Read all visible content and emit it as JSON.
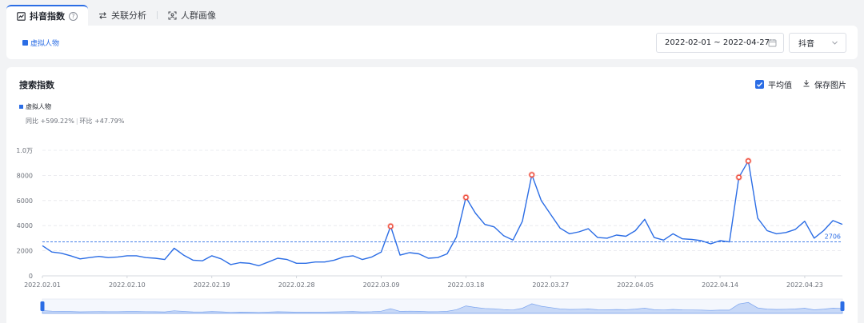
{
  "tabs": [
    {
      "label": "抖音指数",
      "icon": "trend-chart-icon",
      "active": true,
      "help": "?"
    },
    {
      "label": "关联分析",
      "icon": "swap-arrows-icon",
      "active": false
    },
    {
      "label": "人群画像",
      "icon": "face-scan-icon",
      "active": false
    }
  ],
  "filter": {
    "keyword": "虚拟人物",
    "date_range": "2022-02-01 ~ 2022-04-27",
    "platform": "抖音"
  },
  "chart_card": {
    "title": "搜索指数",
    "avg_label": "平均值",
    "avg_checked": true,
    "save_label": "保存图片",
    "series_name": "虚拟人物",
    "yoy": "同比 +599.22%",
    "stats_sep": "|",
    "mom": "环比 +47.79%"
  },
  "colors": {
    "accent": "#2b6de5",
    "peak": "#ef4d3c",
    "grid": "#e5e6eb"
  },
  "chart_data": {
    "type": "line",
    "title": "搜索指数",
    "xlabel": "",
    "ylabel": "",
    "ylim": [
      0,
      10000
    ],
    "y_ticks": [
      "0",
      "2000",
      "4000",
      "6000",
      "8000",
      "1.0万"
    ],
    "x_tick_labels": [
      "2022.02.01",
      "2022.02.10",
      "2022.02.19",
      "2022.02.28",
      "2022.03.09",
      "2022.03.18",
      "2022.03.27",
      "2022.04.05",
      "2022.04.14",
      "2022.04.23"
    ],
    "average": 2706,
    "average_label": "2706",
    "series": [
      {
        "name": "虚拟人物",
        "values": [
          2400,
          1900,
          1800,
          1600,
          1350,
          1450,
          1550,
          1450,
          1500,
          1600,
          1600,
          1450,
          1400,
          1300,
          2200,
          1650,
          1250,
          1200,
          1600,
          1350,
          900,
          1050,
          1000,
          800,
          1100,
          1400,
          1300,
          1000,
          1000,
          1100,
          1100,
          1250,
          1500,
          1600,
          1300,
          1500,
          1900,
          3950,
          1650,
          1850,
          1750,
          1400,
          1450,
          1750,
          3100,
          6250,
          5000,
          4100,
          3900,
          3200,
          2850,
          4350,
          8050,
          6000,
          4900,
          3800,
          3350,
          3500,
          3750,
          3050,
          3000,
          3250,
          3150,
          3600,
          4500,
          3050,
          2850,
          3350,
          2950,
          2900,
          2800,
          2550,
          2800,
          2700,
          7850,
          9150,
          4600,
          3600,
          3350,
          3450,
          3700,
          4350,
          3000,
          3600,
          4400,
          4100
        ]
      }
    ],
    "highlight_points": [
      37,
      45,
      52,
      74,
      75
    ]
  },
  "slider": {
    "start": 0,
    "end": 1
  }
}
